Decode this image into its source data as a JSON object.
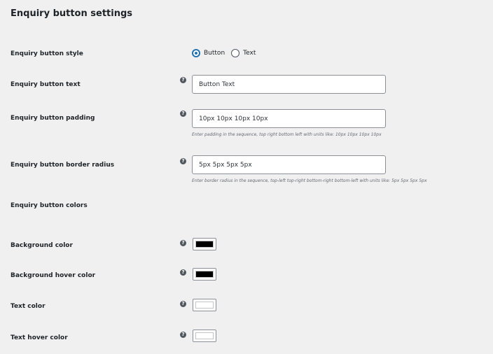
{
  "header": {
    "title": "Enquiry button settings"
  },
  "style_row": {
    "label": "Enquiry button style",
    "options": [
      {
        "label": "Button",
        "selected": true
      },
      {
        "label": "Text",
        "selected": false
      }
    ]
  },
  "text_row": {
    "label": "Enquiry button text",
    "value": "Button Text"
  },
  "padding_row": {
    "label": "Enquiry button padding",
    "value": "10px 10px 10px 10px",
    "description": "Enter padding in the sequence, top right bottom left with units like: 10px 10px 10px 10px"
  },
  "radius_row": {
    "label": "Enquiry button border radius",
    "value": "5px 5px 5px 5px",
    "description": "Enter border radius in the sequence, top-left top-right bottom-right bottom-left with units like: 5px 5px 5px 5px"
  },
  "colors_section": {
    "label": "Enquiry button colors"
  },
  "color_rows": [
    {
      "label": "Background color",
      "color": "#000000"
    },
    {
      "label": "Background hover color",
      "color": "#000000"
    },
    {
      "label": "Text color",
      "color": "#ffffff"
    },
    {
      "label": "Text hover color",
      "color": "#ffffff"
    }
  ],
  "help_icon_glyph": "?",
  "theme": {
    "accent": "#2271b1",
    "background": "#f0f0f1"
  }
}
